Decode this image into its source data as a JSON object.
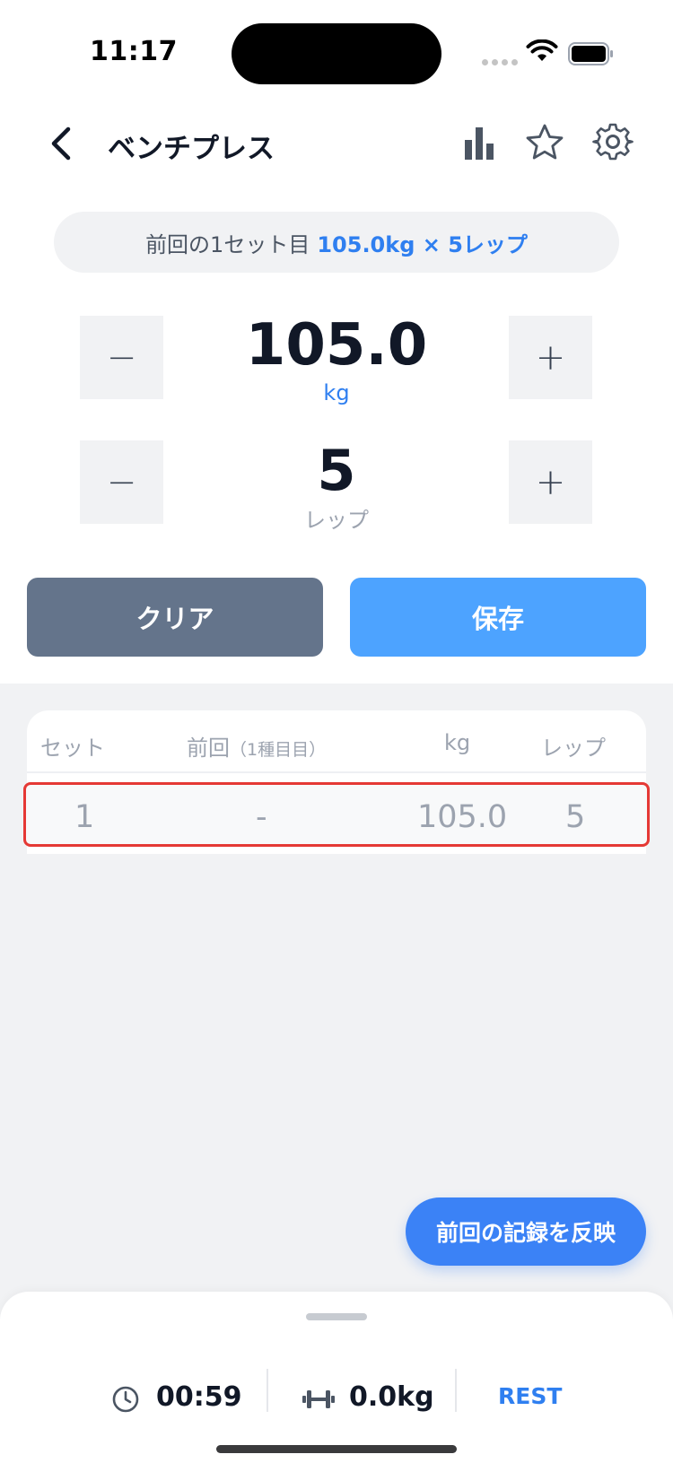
{
  "status_bar": {
    "time": "11:17"
  },
  "header": {
    "title": "ベンチプレス"
  },
  "previous_set": {
    "label": "前回の1セット目",
    "value": "105.0kg × 5レップ"
  },
  "weight_stepper": {
    "minus": "−",
    "value": "105.0",
    "unit": "kg",
    "plus": "+"
  },
  "reps_stepper": {
    "minus": "−",
    "value": "5",
    "unit": "レップ",
    "plus": "+"
  },
  "actions": {
    "clear_label": "クリア",
    "save_label": "保存"
  },
  "table": {
    "headers": {
      "set": "セット",
      "previous": "前回",
      "previous_sub": "（1種目目）",
      "kg": "kg",
      "reps": "レップ"
    },
    "rows": [
      {
        "set": "1",
        "previous": "-",
        "kg": "105.0",
        "reps": "5"
      }
    ]
  },
  "apply_previous_label": "前回の記録を反映",
  "bottom_sheet": {
    "timer": "00:59",
    "total_weight": "0.0kg",
    "rest_label": "REST"
  },
  "colors": {
    "accent": "#2f7ff0",
    "save": "#4da3ff",
    "clear": "#64748b",
    "highlight_border": "#e53935"
  }
}
